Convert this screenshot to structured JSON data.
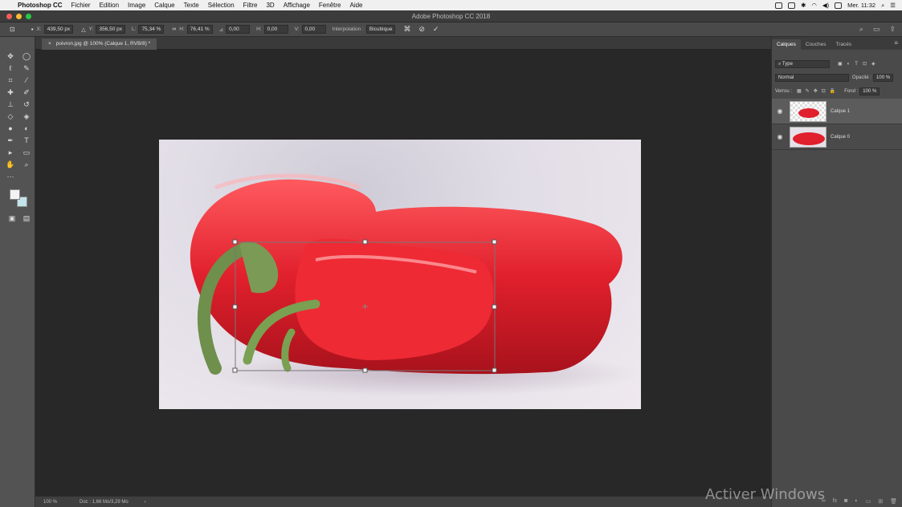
{
  "menubar": {
    "app": "Photoshop CC",
    "items": [
      "Fichier",
      "Edition",
      "Image",
      "Calque",
      "Texte",
      "Sélection",
      "Filtre",
      "3D",
      "Affichage",
      "Fenêtre",
      "Aide"
    ],
    "clock": "Mer. 11:32"
  },
  "window": {
    "title": "Adobe Photoshop CC 2018"
  },
  "options": {
    "x": "439,50 px",
    "y": "356,50 px",
    "w": "75,34 %",
    "h": "76,41 %",
    "angle": "0,00",
    "hskew": "0,00",
    "vskew": "0,00",
    "x_label": "X:",
    "y_label": "Y:",
    "w_label": "L:",
    "h_label": "H:",
    "angle_label": "⊿",
    "hskew_label": "H:",
    "vskew_label": "V:",
    "interp_label": "Interpolation :",
    "interp_value": "Bicubique"
  },
  "document": {
    "tab": "poivron.jpg @ 100% (Calque 1, RVB/8) *",
    "close": "×"
  },
  "status": {
    "zoom": "100 %",
    "doc": "Doc : 1,66 Mo/3,29 Mo",
    "arrow": "›"
  },
  "panel": {
    "tabs": [
      "Calques",
      "Couches",
      "Tracés"
    ],
    "search_placeholder": "Type",
    "blend_mode": "Normal",
    "opacity_label": "Opacité :",
    "opacity_value": "100 %",
    "lock_label": "Verrou :",
    "fill_label": "Fond :",
    "fill_value": "100 %",
    "layers": [
      {
        "name": "Calque 1",
        "selected": true
      },
      {
        "name": "Calque 0",
        "selected": false
      }
    ]
  },
  "watermark": "Activer Windows"
}
